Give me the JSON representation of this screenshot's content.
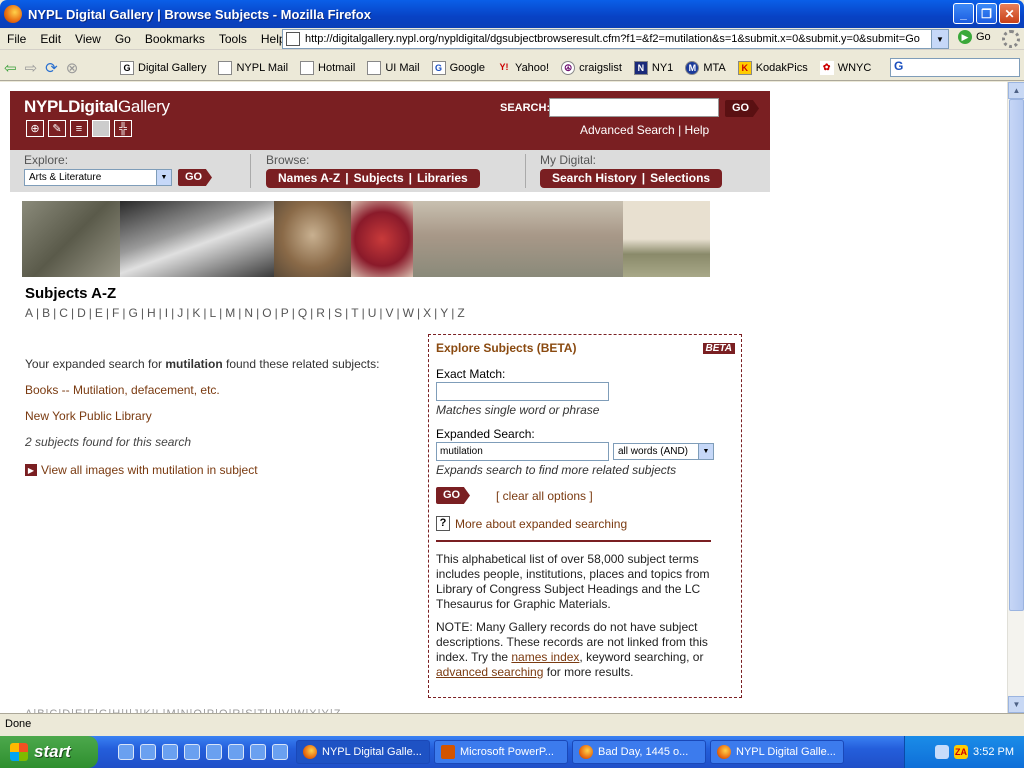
{
  "window": {
    "title": "NYPL Digital Gallery | Browse Subjects - Mozilla Firefox"
  },
  "menus": [
    "File",
    "Edit",
    "View",
    "Go",
    "Bookmarks",
    "Tools",
    "Help"
  ],
  "address_bar": {
    "url": "http://digitalgallery.nypl.org/nypldigital/dgsubjectbrowseresult.cfm?f1=&f2=mutilation&s=1&submit.x=0&submit.y=0&submit=Go",
    "go_label": "Go"
  },
  "bookmarks": [
    {
      "label": "Digital Gallery",
      "icon": "gallery-icon"
    },
    {
      "label": "NYPL Mail",
      "icon": "page-icon"
    },
    {
      "label": "Hotmail",
      "icon": "page-icon"
    },
    {
      "label": "UI Mail",
      "icon": "page-icon"
    },
    {
      "label": "Google",
      "icon": "google-icon"
    },
    {
      "label": "Yahoo!",
      "icon": "yahoo-icon"
    },
    {
      "label": "craigslist",
      "icon": "peace-icon"
    },
    {
      "label": "NY1",
      "icon": "ny1-icon"
    },
    {
      "label": "MTA",
      "icon": "mta-icon"
    },
    {
      "label": "KodakPics",
      "icon": "kodak-icon"
    },
    {
      "label": "WNYC",
      "icon": "wnyc-icon"
    }
  ],
  "bookmarks_overflow": "»",
  "header": {
    "logo_bold": "NYPLDigital",
    "logo_rest": "Gallery",
    "search_label": "SEARCH:",
    "go": "GO",
    "advanced_search": "Advanced Search",
    "help": "Help",
    "link_separator": "|"
  },
  "nav": {
    "explore_label": "Explore:",
    "explore_value": "Arts & Literature",
    "browse_label": "Browse:",
    "browse_items": [
      "Names A-Z",
      "Subjects",
      "Libraries"
    ],
    "mydigital_label": "My Digital:",
    "mydigital_items": [
      "Search History",
      "Selections"
    ],
    "separator": "|"
  },
  "subjects": {
    "heading": "Subjects A-Z",
    "letters": [
      "A",
      "B",
      "C",
      "D",
      "E",
      "F",
      "G",
      "H",
      "I",
      "J",
      "K",
      "L",
      "M",
      "N",
      "O",
      "P",
      "Q",
      "R",
      "S",
      "T",
      "U",
      "V",
      "W",
      "X",
      "Y",
      "Z"
    ],
    "letter_separator": "|",
    "intro_before": "Your expanded search for ",
    "intro_term": "mutilation",
    "intro_after": " found these related subjects:",
    "results": [
      "Books -- Mutilation, defacement, etc.",
      "New York Public Library"
    ],
    "count_text": "2 subjects found for this search",
    "view_all": "View all images with mutilation in subject"
  },
  "explore_box": {
    "title": "Explore Subjects (BETA)",
    "beta": "BETA",
    "exact_label": "Exact Match:",
    "exact_hint": "Matches single word or phrase",
    "expanded_label": "Expanded Search:",
    "expanded_value": "mutilation",
    "mode_value": "all words (AND)",
    "expanded_hint": "Expands search to find more related subjects",
    "go": "GO",
    "clear": "[ clear all options ]",
    "more": "More about expanded searching",
    "para1": "This alphabetical list of over 58,000 subject terms includes people, institutions, places and topics from Library of Congress Subject Headings and the LC Thesaurus for Graphic Materials.",
    "para2_a": "NOTE: Many Gallery records do not have subject descriptions. These records are not linked from this index. Try the ",
    "para2_link1": "names index",
    "para2_b": ", keyword searching, or ",
    "para2_link2": "advanced searching",
    "para2_c": " for more results."
  },
  "status": {
    "text": "Done"
  },
  "taskbar": {
    "start": "start",
    "tasks": [
      {
        "label": "NYPL Digital Galle...",
        "active": true
      },
      {
        "label": "Microsoft PowerP...",
        "active": false
      },
      {
        "label": "Bad Day, 1445 o...",
        "active": false
      },
      {
        "label": "NYPL Digital Galle...",
        "active": false
      }
    ],
    "clock": "3:52 PM"
  },
  "colors": {
    "brand": "#7a1f22",
    "link": "#7a3a10",
    "nav_bg": "#dcdcdc"
  }
}
